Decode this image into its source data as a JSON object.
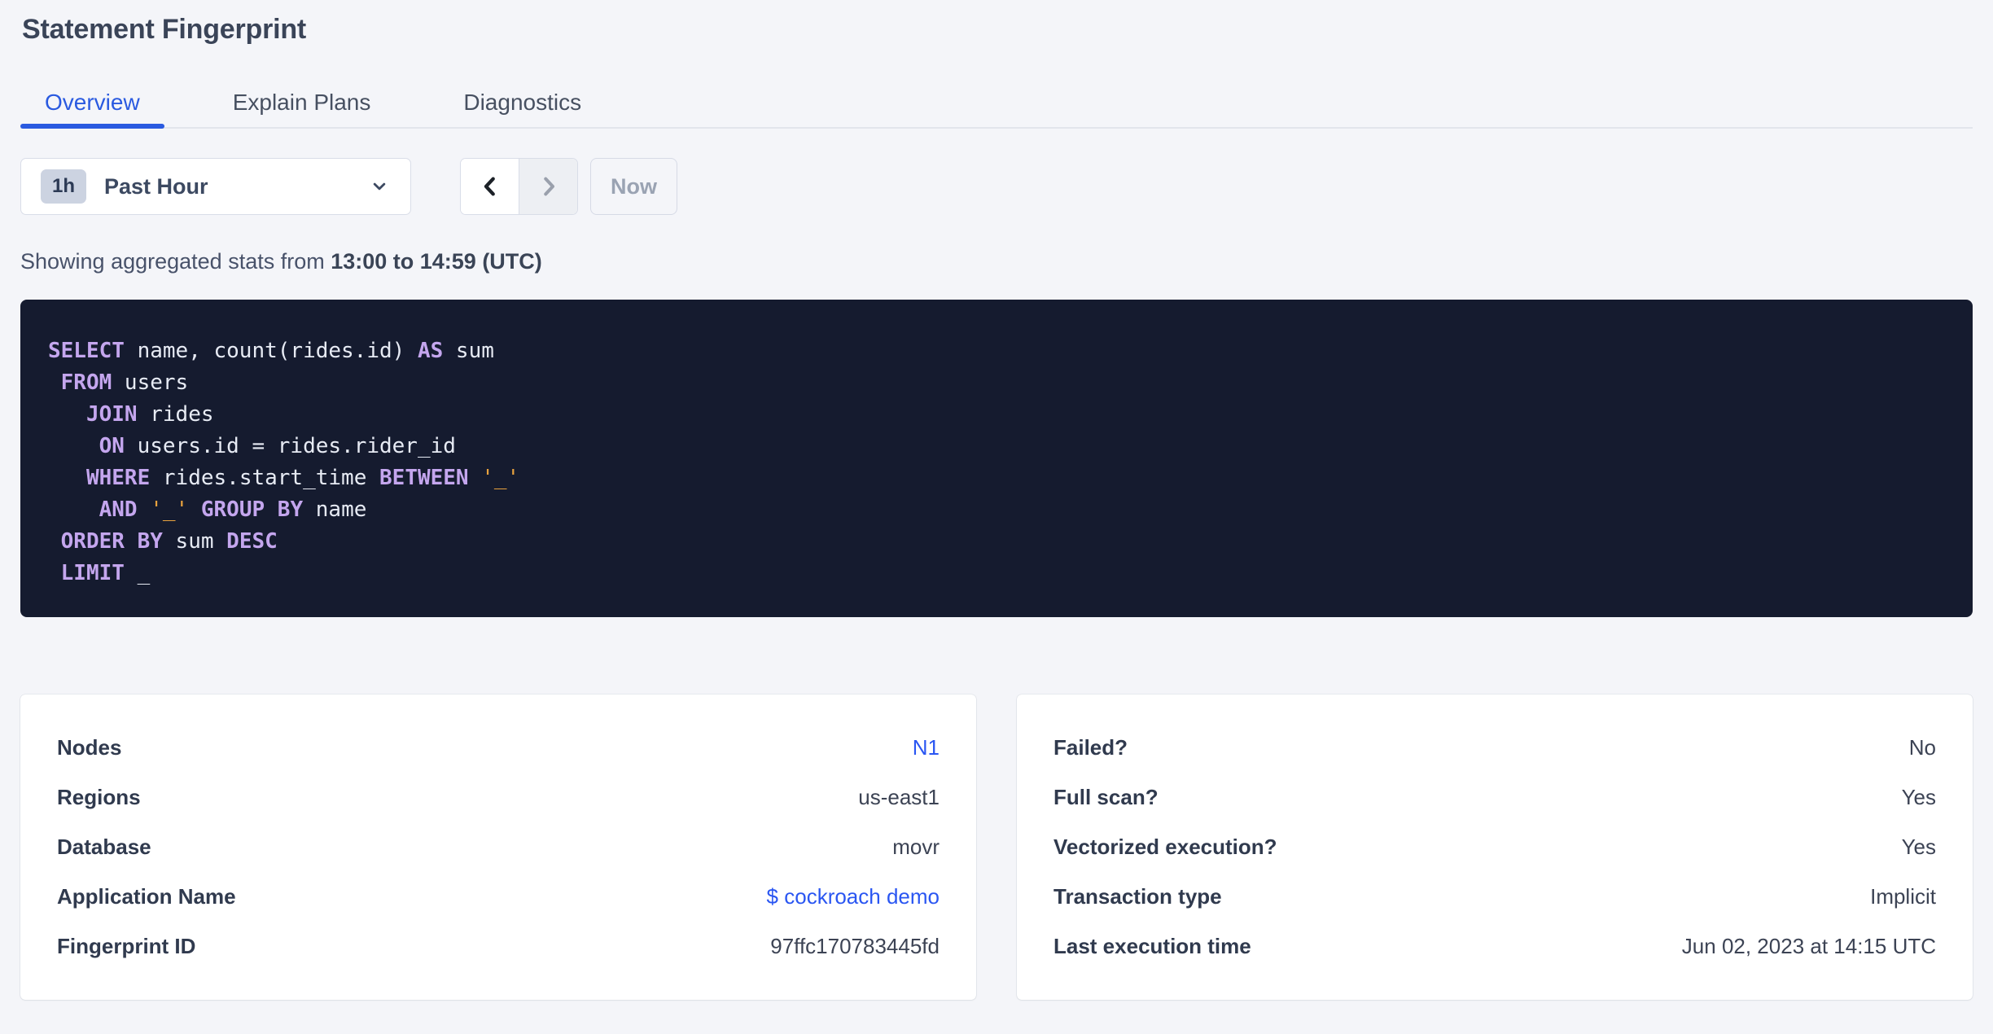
{
  "page": {
    "title": "Statement Fingerprint"
  },
  "tabs": [
    {
      "id": "overview",
      "label": "Overview",
      "active": true
    },
    {
      "id": "explain-plans",
      "label": "Explain Plans",
      "active": false
    },
    {
      "id": "diagnostics",
      "label": "Diagnostics",
      "active": false
    }
  ],
  "time_picker": {
    "badge": "1h",
    "label": "Past Hour",
    "prev_enabled": true,
    "next_enabled": false,
    "now_label": "Now"
  },
  "stats_line": {
    "prefix": "Showing aggregated stats from ",
    "range": "13:00 to 14:59 (UTC)"
  },
  "sql": {
    "lines": [
      [
        {
          "t": "SELECT",
          "c": "kw"
        },
        {
          "t": " name, count(rides.id) ",
          "c": "pl"
        },
        {
          "t": "AS",
          "c": "kw"
        },
        {
          "t": " sum",
          "c": "pl"
        }
      ],
      [
        {
          "t": " ",
          "c": "pl"
        },
        {
          "t": "FROM",
          "c": "kw"
        },
        {
          "t": " users",
          "c": "pl"
        }
      ],
      [
        {
          "t": "   ",
          "c": "pl"
        },
        {
          "t": "JOIN",
          "c": "kw"
        },
        {
          "t": " rides",
          "c": "pl"
        }
      ],
      [
        {
          "t": "    ",
          "c": "pl"
        },
        {
          "t": "ON",
          "c": "kw"
        },
        {
          "t": " users.id = rides.rider_id",
          "c": "pl"
        }
      ],
      [
        {
          "t": "   ",
          "c": "pl"
        },
        {
          "t": "WHERE",
          "c": "kw"
        },
        {
          "t": " rides.start_time ",
          "c": "pl"
        },
        {
          "t": "BETWEEN",
          "c": "kw"
        },
        {
          "t": " ",
          "c": "pl"
        },
        {
          "t": "'_'",
          "c": "str"
        }
      ],
      [
        {
          "t": "    ",
          "c": "pl"
        },
        {
          "t": "AND",
          "c": "kw"
        },
        {
          "t": " ",
          "c": "pl"
        },
        {
          "t": "'_'",
          "c": "str"
        },
        {
          "t": " ",
          "c": "pl"
        },
        {
          "t": "GROUP BY",
          "c": "kw"
        },
        {
          "t": " name",
          "c": "pl"
        }
      ],
      [
        {
          "t": " ",
          "c": "pl"
        },
        {
          "t": "ORDER BY",
          "c": "kw"
        },
        {
          "t": " sum ",
          "c": "pl"
        },
        {
          "t": "DESC",
          "c": "kw"
        }
      ],
      [
        {
          "t": " ",
          "c": "pl"
        },
        {
          "t": "LIMIT",
          "c": "kw"
        },
        {
          "t": " _",
          "c": "pl"
        }
      ]
    ]
  },
  "cards": {
    "left": {
      "rows": [
        {
          "label": "Nodes",
          "value": "N1",
          "link": true
        },
        {
          "label": "Regions",
          "value": "us-east1",
          "link": false
        },
        {
          "label": "Database",
          "value": "movr",
          "link": false
        },
        {
          "label": "Application Name",
          "value": "$ cockroach demo",
          "link": true
        },
        {
          "label": "Fingerprint ID",
          "value": "97ffc170783445fd",
          "link": false
        }
      ]
    },
    "right": {
      "rows": [
        {
          "label": "Failed?",
          "value": "No",
          "link": false
        },
        {
          "label": "Full scan?",
          "value": "Yes",
          "link": false
        },
        {
          "label": "Vectorized execution?",
          "value": "Yes",
          "link": false
        },
        {
          "label": "Transaction type",
          "value": "Implicit",
          "link": false
        },
        {
          "label": "Last execution time",
          "value": "Jun 02, 2023 at 14:15 UTC",
          "link": false
        }
      ]
    }
  },
  "colors": {
    "page_background": "#f4f5f9",
    "accent_tab_blue": "#2a5ae0",
    "link_blue": "#2a56f2",
    "code_background": "#151b2f",
    "code_keyword": "#c4a6ee",
    "code_plain": "#e7ebf4",
    "code_string": "#e8a23e",
    "disabled_text": "#9aa3b3"
  }
}
